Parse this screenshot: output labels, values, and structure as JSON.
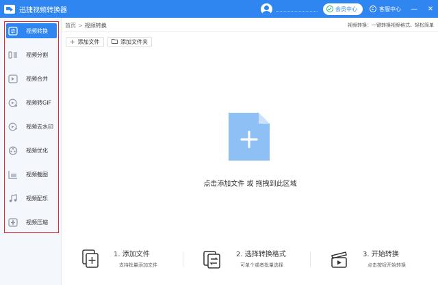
{
  "app": {
    "title": "迅捷视频转换器"
  },
  "titlebar": {
    "vip_label": "会员中心",
    "support_label": "客服中心",
    "minimize": "—",
    "close": "✕"
  },
  "sidebar": {
    "items": [
      {
        "label": "视频转换",
        "icon": "video-convert-icon",
        "active": true
      },
      {
        "label": "视频分割",
        "icon": "video-split-icon"
      },
      {
        "label": "视频合并",
        "icon": "video-merge-icon"
      },
      {
        "label": "视频转GIF",
        "icon": "video-gif-icon"
      },
      {
        "label": "视频去水印",
        "icon": "watermark-remove-icon"
      },
      {
        "label": "视频优化",
        "icon": "video-optimize-icon"
      },
      {
        "label": "视频截图",
        "icon": "screenshot-icon"
      },
      {
        "label": "视频配乐",
        "icon": "music-icon"
      },
      {
        "label": "视频压缩",
        "icon": "compress-icon"
      }
    ]
  },
  "main": {
    "breadcrumb": {
      "home": "首页",
      "separator": ">",
      "current": "视频转换"
    },
    "hint": "视频转换：一键转换视频格式、轻松简单",
    "toolbar": {
      "add_file": "添加文件",
      "add_folder": "添加文件夹"
    },
    "drop_text": "点击添加文件 或 拖拽到此区域",
    "steps": [
      {
        "title": "1. 添加文件",
        "desc": "支持批量添加文件"
      },
      {
        "title": "2. 选择转换格式",
        "desc": "可单个或者批量选择"
      },
      {
        "title": "3. 开始转换",
        "desc": "点击按钮开始转换"
      }
    ]
  },
  "colors": {
    "accent": "#2f86f0",
    "highlight_frame": "#e02b2b",
    "file_icon": "#8ec0f5"
  }
}
